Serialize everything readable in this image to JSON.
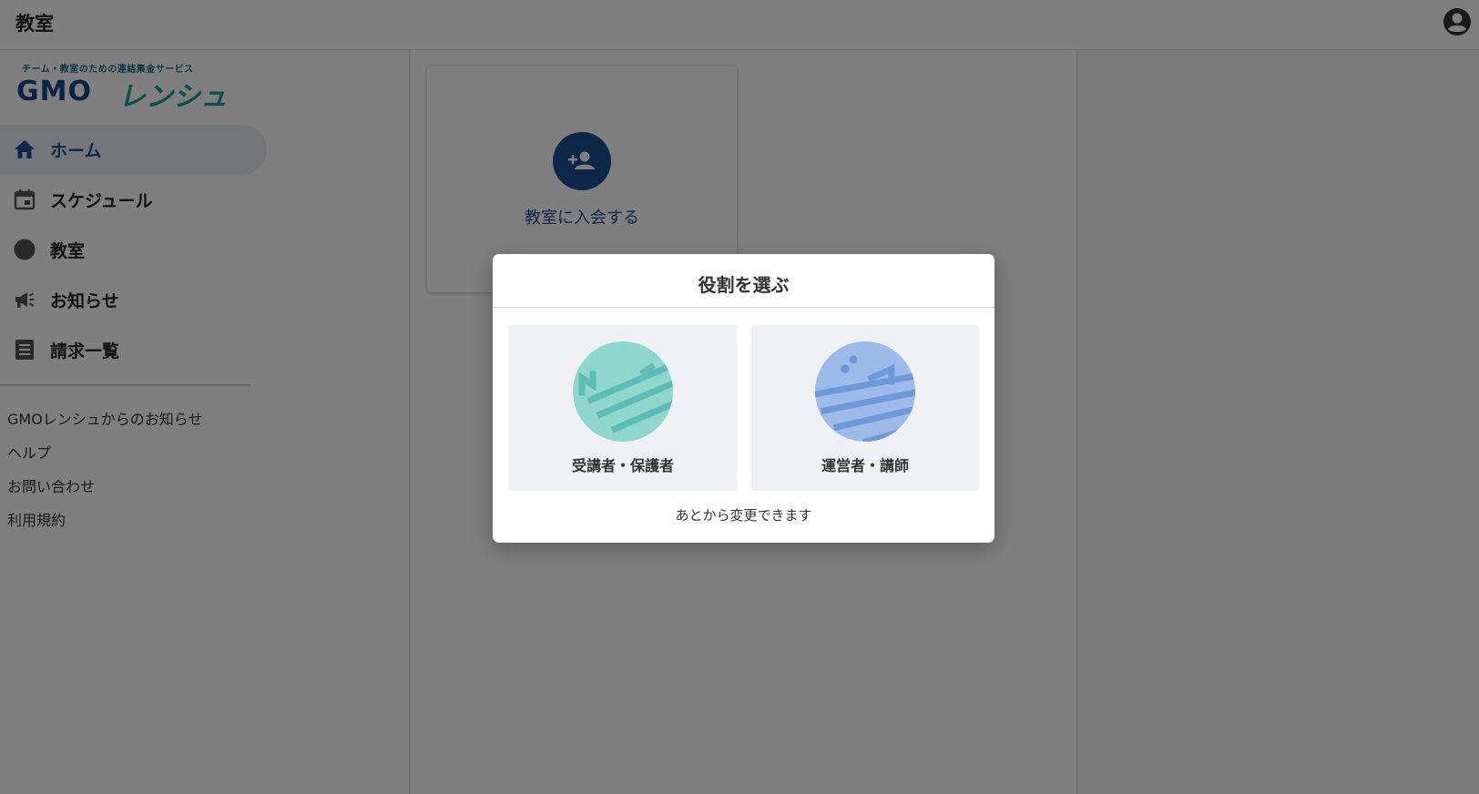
{
  "appbar": {
    "title": "教室"
  },
  "logo": {
    "tagline": "チーム・教室のための連絡集金サービス",
    "brand_gmo": "GMO",
    "brand_name": "レンシュ"
  },
  "sidebar": {
    "items": [
      {
        "label": "ホーム",
        "icon": "home-icon",
        "active": true
      },
      {
        "label": "スケジュール",
        "icon": "calendar-icon",
        "active": false
      },
      {
        "label": "教室",
        "icon": "circle-icon",
        "active": false
      },
      {
        "label": "お知らせ",
        "icon": "megaphone-icon",
        "active": false
      },
      {
        "label": "請求一覧",
        "icon": "list-icon",
        "active": false
      }
    ],
    "links": [
      "GMOレンシュからのお知らせ",
      "ヘルプ",
      "お問い合わせ",
      "利用規約"
    ]
  },
  "main": {
    "join_label": "教室に入会する"
  },
  "dialog": {
    "title": "役割を選ぶ",
    "roles": [
      {
        "label": "受講者・保護者",
        "icon": "student-role-illustration",
        "color": "#8fd6cf"
      },
      {
        "label": "運営者・講師",
        "icon": "staff-role-illustration",
        "color": "#9dbbe8"
      }
    ],
    "note": "あとから変更できます"
  },
  "colors": {
    "primary": "#1d4f91",
    "brand_teal": "#13a39a",
    "overlay": "rgba(0,0,0,0.5)"
  }
}
